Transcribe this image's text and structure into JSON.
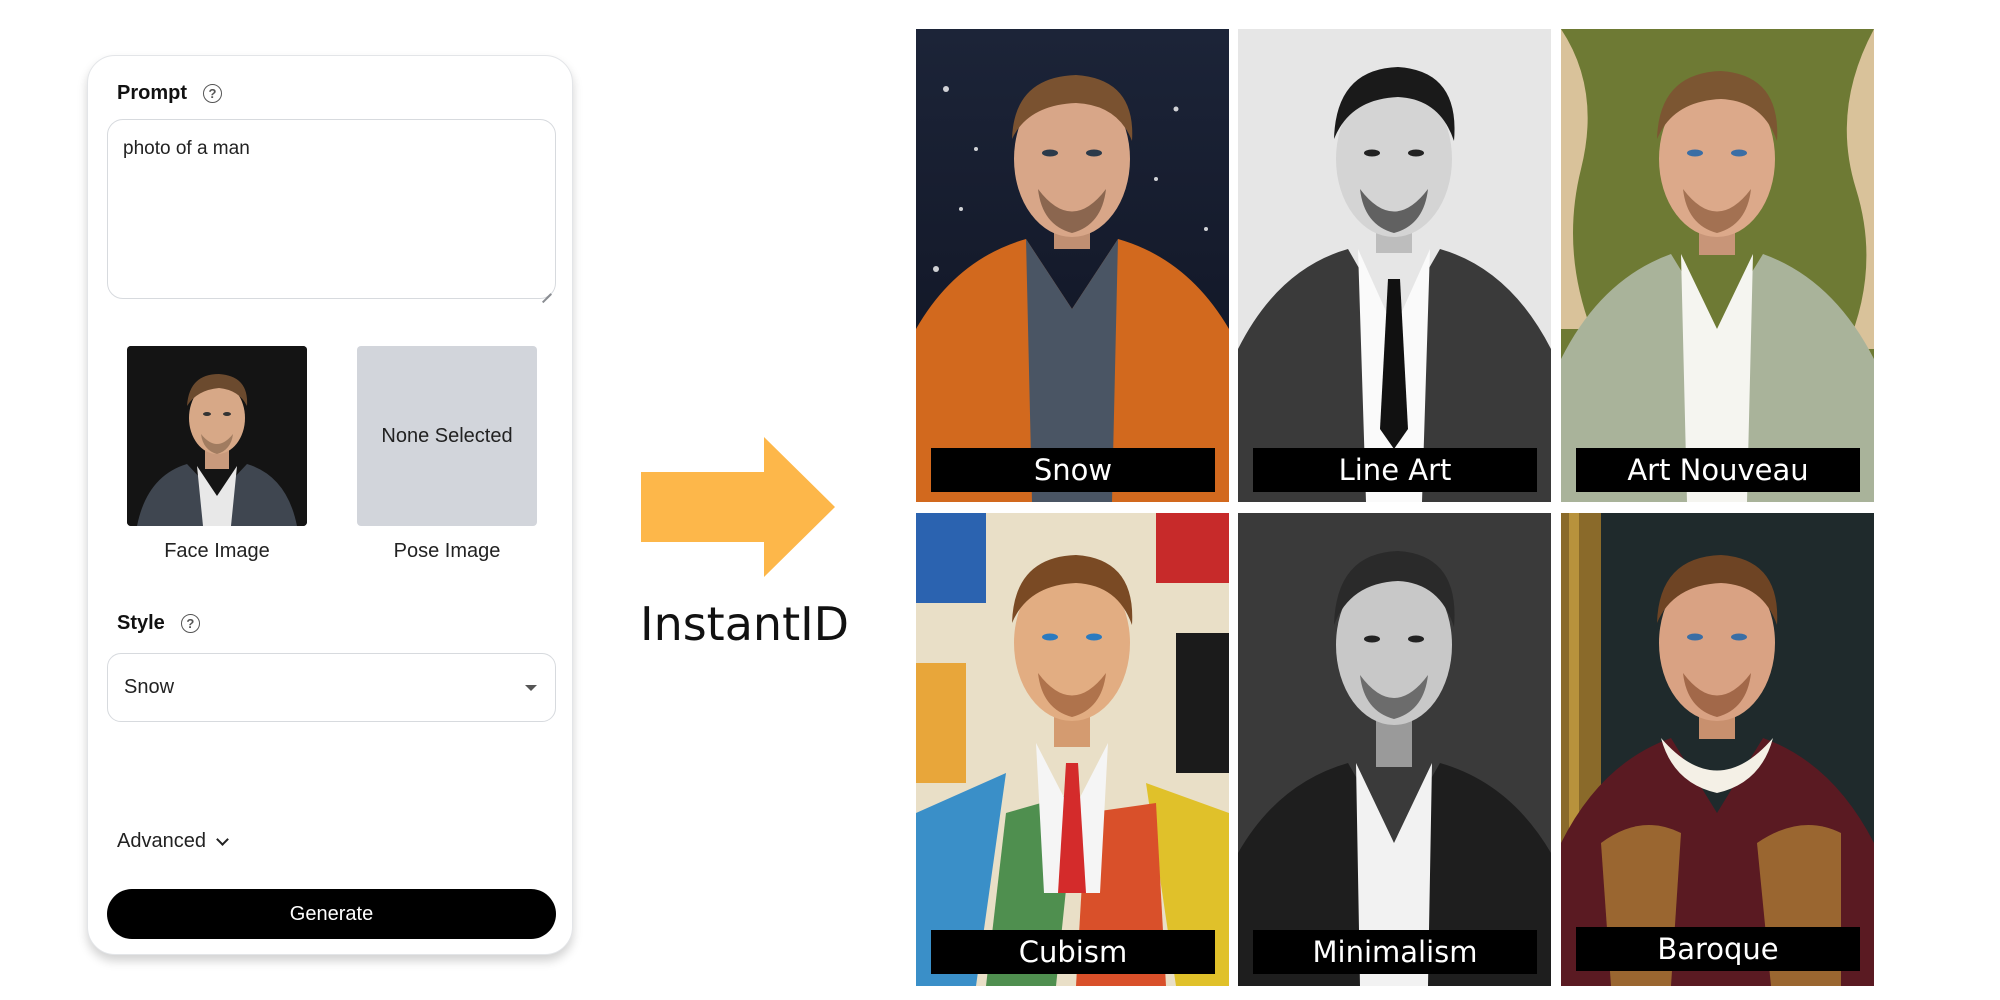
{
  "panel": {
    "prompt": {
      "label": "Prompt",
      "value": "photo of a man"
    },
    "face_image": {
      "caption": "Face Image"
    },
    "pose_image": {
      "caption": "Pose Image",
      "placeholder": "None Selected"
    },
    "style": {
      "label": "Style",
      "selected": "Snow"
    },
    "advanced_label": "Advanced",
    "generate_label": "Generate"
  },
  "arrow": {
    "color": "#FDB74A",
    "caption": "InstantID"
  },
  "gallery": [
    {
      "label": "Snow"
    },
    {
      "label": "Line Art"
    },
    {
      "label": "Art Nouveau"
    },
    {
      "label": "Cubism"
    },
    {
      "label": "Minimalism"
    },
    {
      "label": "Baroque"
    }
  ]
}
